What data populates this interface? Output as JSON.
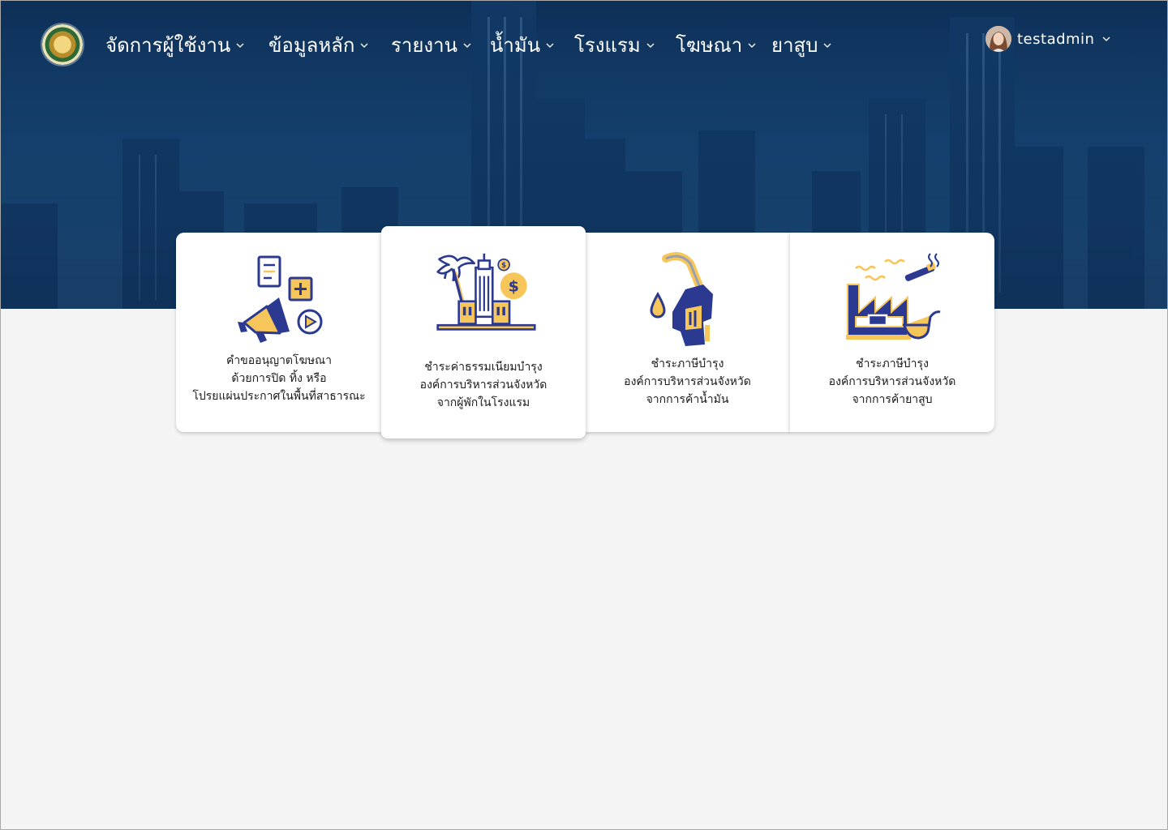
{
  "nav": {
    "logo_name": "provincial-seal-logo",
    "items": [
      {
        "label": "จัดการผู้ใช้งาน"
      },
      {
        "label": "ข้อมูลหลัก"
      },
      {
        "label": "รายงาน"
      },
      {
        "label": "น้ำมัน"
      },
      {
        "label": "โรงแรม"
      },
      {
        "label": "โฆษณา"
      },
      {
        "label": "ยาสูบ"
      }
    ],
    "user": {
      "name": "testadmin"
    }
  },
  "cards": [
    {
      "icon": "advertising-megaphone-icon",
      "label": "คำขออนุญาตโฆษณา\nด้วยการปิด ทิ้ง หรือ\nโปรยแผ่นประกาศในพื้นที่สาธารณะ"
    },
    {
      "icon": "hotel-building-icon",
      "label": "ชำระค่าธรรมเนียมบำรุง\nองค์การบริหารส่วนจังหวัด\nจากผู้พักในโรงแรม"
    },
    {
      "icon": "fuel-nozzle-icon",
      "label": "ชำระภาษีบำรุง\nองค์การบริหารส่วนจังหวัด\nจากการค้าน้ำมัน"
    },
    {
      "icon": "tobacco-factory-icon",
      "label": "ชำระภาษีบำรุง\nองค์การบริหารส่วนจังหวัด\nจากการค้ายาสูบ"
    }
  ],
  "colors": {
    "accent_navy": "#2b3990",
    "accent_yellow": "#f6c65b",
    "hero_blue": "#174574"
  }
}
